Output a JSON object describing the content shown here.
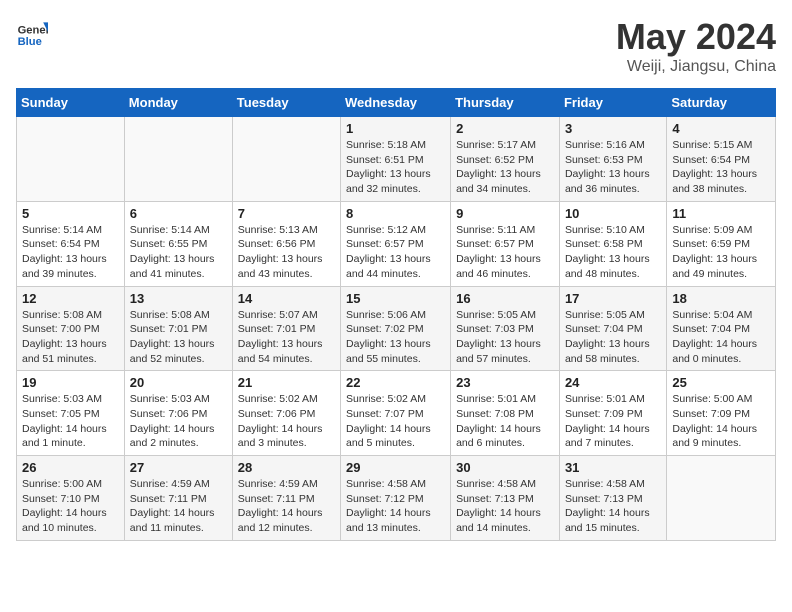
{
  "header": {
    "logo_general": "General",
    "logo_blue": "Blue",
    "month": "May 2024",
    "location": "Weiji, Jiangsu, China"
  },
  "days_of_week": [
    "Sunday",
    "Monday",
    "Tuesday",
    "Wednesday",
    "Thursday",
    "Friday",
    "Saturday"
  ],
  "weeks": [
    [
      {
        "day": "",
        "info": ""
      },
      {
        "day": "",
        "info": ""
      },
      {
        "day": "",
        "info": ""
      },
      {
        "day": "1",
        "info": "Sunrise: 5:18 AM\nSunset: 6:51 PM\nDaylight: 13 hours\nand 32 minutes."
      },
      {
        "day": "2",
        "info": "Sunrise: 5:17 AM\nSunset: 6:52 PM\nDaylight: 13 hours\nand 34 minutes."
      },
      {
        "day": "3",
        "info": "Sunrise: 5:16 AM\nSunset: 6:53 PM\nDaylight: 13 hours\nand 36 minutes."
      },
      {
        "day": "4",
        "info": "Sunrise: 5:15 AM\nSunset: 6:54 PM\nDaylight: 13 hours\nand 38 minutes."
      }
    ],
    [
      {
        "day": "5",
        "info": "Sunrise: 5:14 AM\nSunset: 6:54 PM\nDaylight: 13 hours\nand 39 minutes."
      },
      {
        "day": "6",
        "info": "Sunrise: 5:14 AM\nSunset: 6:55 PM\nDaylight: 13 hours\nand 41 minutes."
      },
      {
        "day": "7",
        "info": "Sunrise: 5:13 AM\nSunset: 6:56 PM\nDaylight: 13 hours\nand 43 minutes."
      },
      {
        "day": "8",
        "info": "Sunrise: 5:12 AM\nSunset: 6:57 PM\nDaylight: 13 hours\nand 44 minutes."
      },
      {
        "day": "9",
        "info": "Sunrise: 5:11 AM\nSunset: 6:57 PM\nDaylight: 13 hours\nand 46 minutes."
      },
      {
        "day": "10",
        "info": "Sunrise: 5:10 AM\nSunset: 6:58 PM\nDaylight: 13 hours\nand 48 minutes."
      },
      {
        "day": "11",
        "info": "Sunrise: 5:09 AM\nSunset: 6:59 PM\nDaylight: 13 hours\nand 49 minutes."
      }
    ],
    [
      {
        "day": "12",
        "info": "Sunrise: 5:08 AM\nSunset: 7:00 PM\nDaylight: 13 hours\nand 51 minutes."
      },
      {
        "day": "13",
        "info": "Sunrise: 5:08 AM\nSunset: 7:01 PM\nDaylight: 13 hours\nand 52 minutes."
      },
      {
        "day": "14",
        "info": "Sunrise: 5:07 AM\nSunset: 7:01 PM\nDaylight: 13 hours\nand 54 minutes."
      },
      {
        "day": "15",
        "info": "Sunrise: 5:06 AM\nSunset: 7:02 PM\nDaylight: 13 hours\nand 55 minutes."
      },
      {
        "day": "16",
        "info": "Sunrise: 5:05 AM\nSunset: 7:03 PM\nDaylight: 13 hours\nand 57 minutes."
      },
      {
        "day": "17",
        "info": "Sunrise: 5:05 AM\nSunset: 7:04 PM\nDaylight: 13 hours\nand 58 minutes."
      },
      {
        "day": "18",
        "info": "Sunrise: 5:04 AM\nSunset: 7:04 PM\nDaylight: 14 hours\nand 0 minutes."
      }
    ],
    [
      {
        "day": "19",
        "info": "Sunrise: 5:03 AM\nSunset: 7:05 PM\nDaylight: 14 hours\nand 1 minute."
      },
      {
        "day": "20",
        "info": "Sunrise: 5:03 AM\nSunset: 7:06 PM\nDaylight: 14 hours\nand 2 minutes."
      },
      {
        "day": "21",
        "info": "Sunrise: 5:02 AM\nSunset: 7:06 PM\nDaylight: 14 hours\nand 3 minutes."
      },
      {
        "day": "22",
        "info": "Sunrise: 5:02 AM\nSunset: 7:07 PM\nDaylight: 14 hours\nand 5 minutes."
      },
      {
        "day": "23",
        "info": "Sunrise: 5:01 AM\nSunset: 7:08 PM\nDaylight: 14 hours\nand 6 minutes."
      },
      {
        "day": "24",
        "info": "Sunrise: 5:01 AM\nSunset: 7:09 PM\nDaylight: 14 hours\nand 7 minutes."
      },
      {
        "day": "25",
        "info": "Sunrise: 5:00 AM\nSunset: 7:09 PM\nDaylight: 14 hours\nand 9 minutes."
      }
    ],
    [
      {
        "day": "26",
        "info": "Sunrise: 5:00 AM\nSunset: 7:10 PM\nDaylight: 14 hours\nand 10 minutes."
      },
      {
        "day": "27",
        "info": "Sunrise: 4:59 AM\nSunset: 7:11 PM\nDaylight: 14 hours\nand 11 minutes."
      },
      {
        "day": "28",
        "info": "Sunrise: 4:59 AM\nSunset: 7:11 PM\nDaylight: 14 hours\nand 12 minutes."
      },
      {
        "day": "29",
        "info": "Sunrise: 4:58 AM\nSunset: 7:12 PM\nDaylight: 14 hours\nand 13 minutes."
      },
      {
        "day": "30",
        "info": "Sunrise: 4:58 AM\nSunset: 7:13 PM\nDaylight: 14 hours\nand 14 minutes."
      },
      {
        "day": "31",
        "info": "Sunrise: 4:58 AM\nSunset: 7:13 PM\nDaylight: 14 hours\nand 15 minutes."
      },
      {
        "day": "",
        "info": ""
      }
    ]
  ]
}
